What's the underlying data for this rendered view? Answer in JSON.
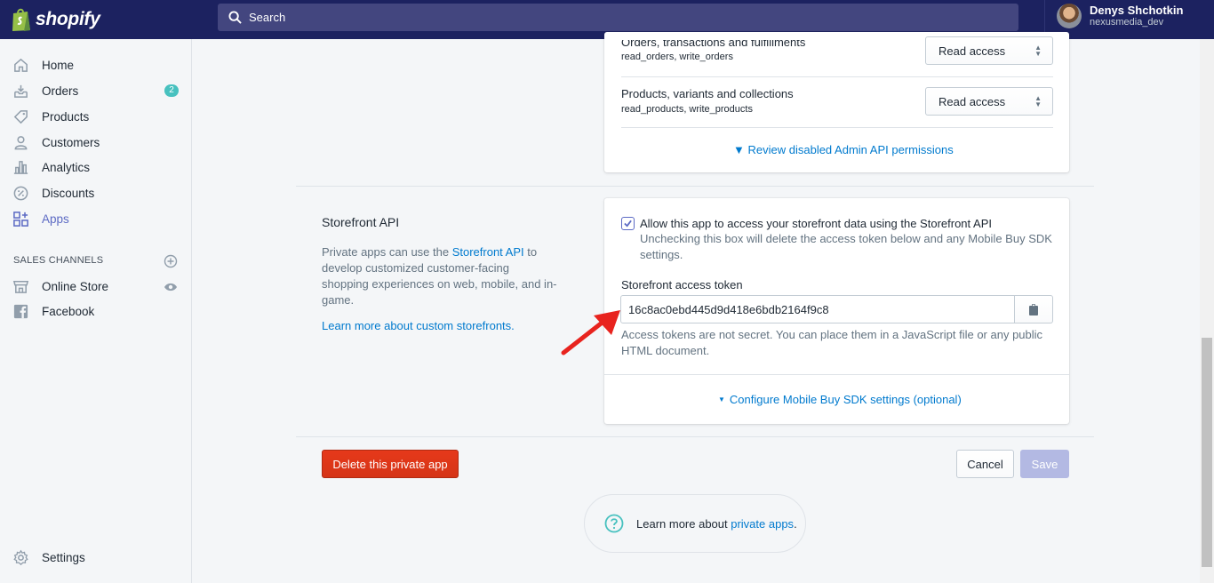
{
  "header": {
    "logo": "shopify",
    "search_placeholder": "Search",
    "user_name": "Denys Shchotkin",
    "user_store": "nexusmedia_dev"
  },
  "sidebar": {
    "items": [
      {
        "label": "Home",
        "icon": "home-icon"
      },
      {
        "label": "Orders",
        "icon": "orders-icon",
        "badge": "2"
      },
      {
        "label": "Products",
        "icon": "tag-icon"
      },
      {
        "label": "Customers",
        "icon": "person-icon"
      },
      {
        "label": "Analytics",
        "icon": "bar-chart-icon"
      },
      {
        "label": "Discounts",
        "icon": "discount-icon"
      },
      {
        "label": "Apps",
        "icon": "apps-icon",
        "active": true
      }
    ],
    "sales_channels_title": "SALES CHANNELS",
    "channels": [
      {
        "label": "Online Store",
        "icon": "store-icon"
      },
      {
        "label": "Facebook",
        "icon": "facebook-icon"
      }
    ],
    "settings": "Settings"
  },
  "admin_api": {
    "permissions": [
      {
        "title": "Orders, transactions and fulfillments",
        "scope": "read_orders, write_orders",
        "access": "Read access"
      },
      {
        "title": "Products, variants and collections",
        "scope": "read_products, write_products",
        "access": "Read access"
      }
    ],
    "review_link": "Review disabled Admin API permissions"
  },
  "storefront": {
    "heading": "Storefront API",
    "desc_before": "Private apps can use the ",
    "desc_link": "Storefront API",
    "desc_after": " to develop customized customer-facing shopping experiences on web, mobile, and in-game.",
    "learn_more": "Learn more about custom storefronts.",
    "checkbox_label": "Allow this app to access your storefront data using the Storefront API",
    "checkbox_help": "Unchecking this box will delete the access token below and any Mobile Buy SDK settings.",
    "checkbox_checked": true,
    "token_label": "Storefront access token",
    "token_value": "16c8ac0ebd445d9d418e6bdb2164f9c8",
    "token_help": "Access tokens are not secret. You can place them in a JavaScript file or any public HTML document.",
    "mobile_link": "Configure Mobile Buy SDK settings (optional)"
  },
  "actions": {
    "delete": "Delete this private app",
    "cancel": "Cancel",
    "save": "Save"
  },
  "footer": {
    "before": "Learn more about ",
    "link": "private apps",
    "after": "."
  },
  "colors": {
    "topbar": "#1c2260",
    "accent": "#5c6ac4",
    "link": "#007ace",
    "danger": "#de3618"
  }
}
